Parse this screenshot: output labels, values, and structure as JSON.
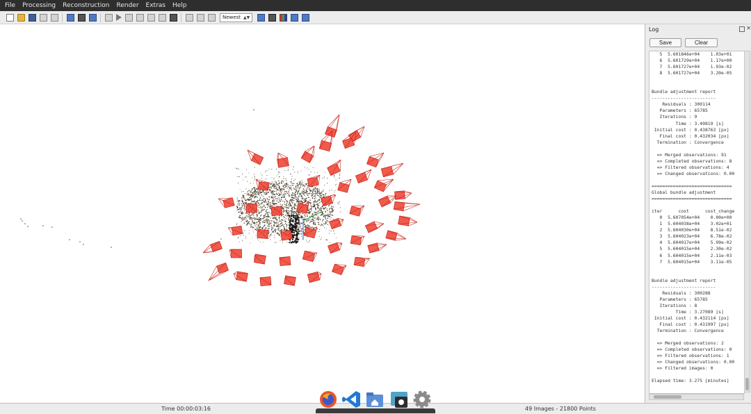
{
  "menu": [
    "File",
    "Processing",
    "Reconstruction",
    "Render",
    "Extras",
    "Help"
  ],
  "toolbar": {
    "icons": [
      "new-icon",
      "open-icon",
      "save-icon",
      "import-icon",
      "export-icon",
      "grid-icon",
      "table-icon",
      "window-icon",
      "undo-icon",
      "play-icon",
      "step-icon",
      "pause-icon",
      "gear-icon",
      "tools-icon",
      "contrast-icon",
      "match-icon",
      "list-icon",
      "book-icon",
      "pose-icon",
      "camera-icon",
      "render-icon",
      "colormap-icon",
      "histogram-icon",
      "screenshot-icon"
    ],
    "sort_select": "Newest"
  },
  "log": {
    "title": "Log",
    "save_label": "Save",
    "clear_label": "Clear",
    "text": "   5  5.601846e+04    1.03e+01\n   6  5.601729e+04    1.17e+00\n   7  5.601727e+04    1.93e-02\n   8  5.601727e+04    3.20e-05\n\n\nBundle adjustment report\n------------------------\n    Residuals : 300114\n   Parameters : 65785\n   Iterations : 9\n         Time : 3.49819 [s]\n Initial cost : 0.438763 [px]\n   Final cost : 0.432034 [px]\n  Termination : Convergence\n\n  => Merged observations: 91\n  => Completed observations: 8\n  => Filtered observations: 4\n  => Changed observations: 0.00\n\n==============================\nGlobal bundle adjustment\n==============================\n\niter      cost      cost_change\n   0  5.607054e+04    0.00e+00\n   1  5.604038e+04    3.02e+01\n   2  5.604030e+04    8.51e-02\n   3  5.604023e+04    6.78e-02\n   4  5.604017e+04    5.99e-02\n   5  5.604015e+04    2.30e-02\n   6  5.604015e+04    2.11e-03\n   7  5.604015e+04    3.11e-05\n\n\nBundle adjustment report\n------------------------\n    Residuals : 300288\n   Parameters : 65785\n   Iterations : 8\n         Time : 3.27089 [s]\n Initial cost : 0.432114 [px]\n   Final cost : 0.431997 [px]\n  Termination : Convergence\n\n  => Merged observations: 2\n  => Completed observations: 0\n  => Filtered observations: 1\n  => Changed observations: 0.00\n  => Filtered images: 0\n\nElapsed time: 3.275 [minutes]"
  },
  "status": {
    "time": "Time 00:00:03:16",
    "counts": "49 Images - 21800 Points"
  },
  "colors": {
    "camera_fill": "#f0493a",
    "camera_stroke": "#c8281c",
    "menubar_bg": "#2e2e2e"
  },
  "dock": [
    "firefox-icon",
    "vscode-icon",
    "files-icon",
    "screenshot-icon",
    "settings-icon"
  ]
}
